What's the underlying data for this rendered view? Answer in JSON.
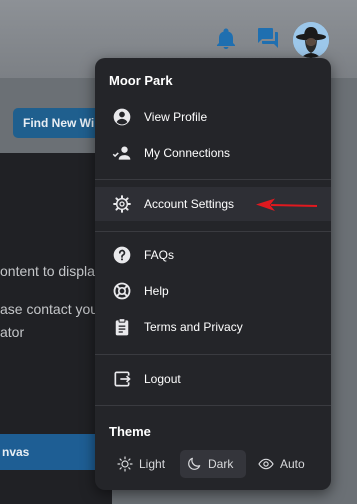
{
  "header": {
    "icons": [
      "bell-icon",
      "chat-icon",
      "user-avatar"
    ]
  },
  "background": {
    "find_button": "Find New Wi",
    "text_line1": "ontent to displa",
    "text_line2": "ase contact you",
    "text_line3": "ator",
    "canvas_button": "nvas"
  },
  "menu": {
    "user_name": "Moor Park",
    "items": [
      {
        "label": "View Profile",
        "icon": "user-circle-icon"
      },
      {
        "label": "My Connections",
        "icon": "connections-icon"
      },
      {
        "label": "Account Settings",
        "icon": "gear-icon"
      },
      {
        "label": "FAQs",
        "icon": "question-circle-icon"
      },
      {
        "label": "Help",
        "icon": "lifebuoy-icon"
      },
      {
        "label": "Terms and Privacy",
        "icon": "clipboard-icon"
      },
      {
        "label": "Logout",
        "icon": "logout-icon"
      }
    ],
    "theme": {
      "title": "Theme",
      "options": [
        {
          "label": "Light",
          "icon": "sun-icon"
        },
        {
          "label": "Dark",
          "icon": "moon-icon"
        },
        {
          "label": "Auto",
          "icon": "eye-icon"
        }
      ],
      "selected": "Dark"
    }
  },
  "annotation": {
    "type": "arrow",
    "color": "#e0191f",
    "points_to": "Account Settings"
  },
  "colors": {
    "menu_bg": "#242529",
    "accent_blue": "#1f5f8e",
    "annotation_red": "#e0191f"
  }
}
